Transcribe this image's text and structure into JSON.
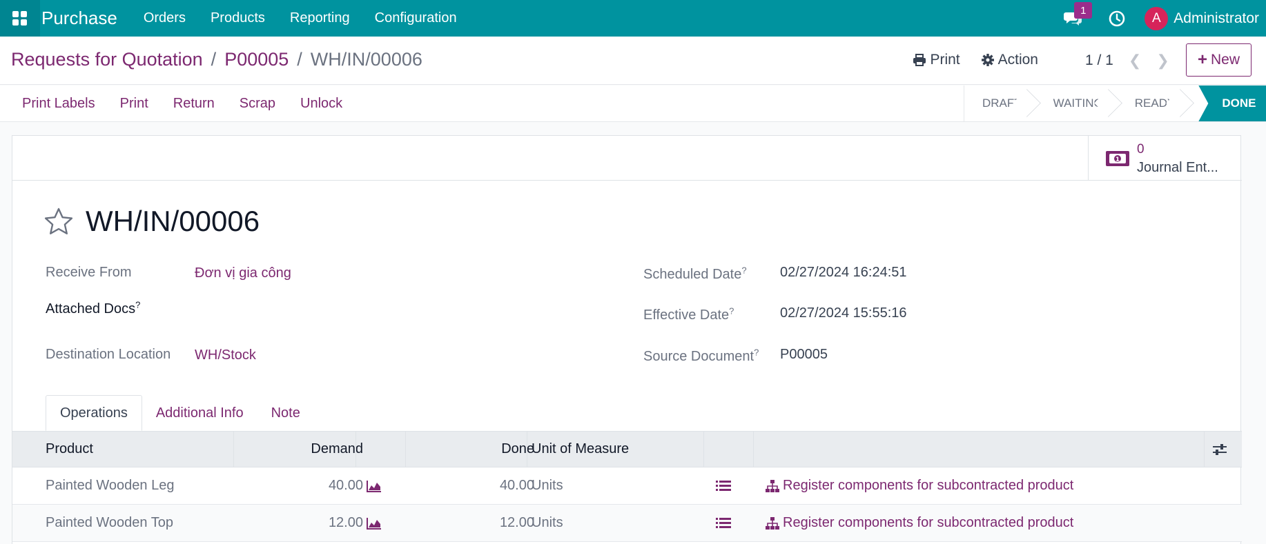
{
  "topbar": {
    "app_name": "Purchase",
    "menu": [
      "Orders",
      "Products",
      "Reporting",
      "Configuration"
    ],
    "chat_badge": "1",
    "avatar_letter": "A",
    "user_name": "Administrator",
    "color": "#00939f"
  },
  "breadcrumb": {
    "items": [
      "Requests for Quotation",
      "P00005"
    ],
    "current": "WH/IN/00006"
  },
  "control_actions": {
    "print": "Print",
    "action": "Action",
    "pager": "1 / 1",
    "new": "New"
  },
  "status_buttons": [
    "Print Labels",
    "Print",
    "Return",
    "Scrap",
    "Unlock"
  ],
  "stages": [
    "DRAFT",
    "WAITING",
    "READY",
    "DONE"
  ],
  "active_stage": "DONE",
  "journal_entries": {
    "count": "0",
    "label": "Journal Ent..."
  },
  "record": {
    "title": "WH/IN/00006",
    "left_fields": [
      {
        "label": "Receive From",
        "value": "Đơn vị gia công"
      },
      {
        "label": "Attached Docs",
        "value": ""
      },
      {
        "label": "Destination Location",
        "value": "WH/Stock"
      }
    ],
    "right_fields": [
      {
        "label": "Scheduled Date",
        "value": "02/27/2024 16:24:51"
      },
      {
        "label": "Effective Date",
        "value": "02/27/2024 15:55:16"
      },
      {
        "label": "Source Document",
        "value": "P00005"
      }
    ],
    "help_mark": "?"
  },
  "tabs": [
    "Operations",
    "Additional Info",
    "Note"
  ],
  "table": {
    "headers": [
      "Product",
      "Demand",
      "Done",
      "Unit of Measure"
    ],
    "rows": [
      {
        "product": "Painted Wooden Leg",
        "demand": "40.00",
        "done": "40.00",
        "uom": "Units",
        "action": "Register components for subcontracted product"
      },
      {
        "product": "Painted Wooden Top",
        "demand": "12.00",
        "done": "12.00",
        "uom": "Units",
        "action": "Register components for subcontracted product"
      }
    ]
  },
  "accent_color": "#7c2870"
}
